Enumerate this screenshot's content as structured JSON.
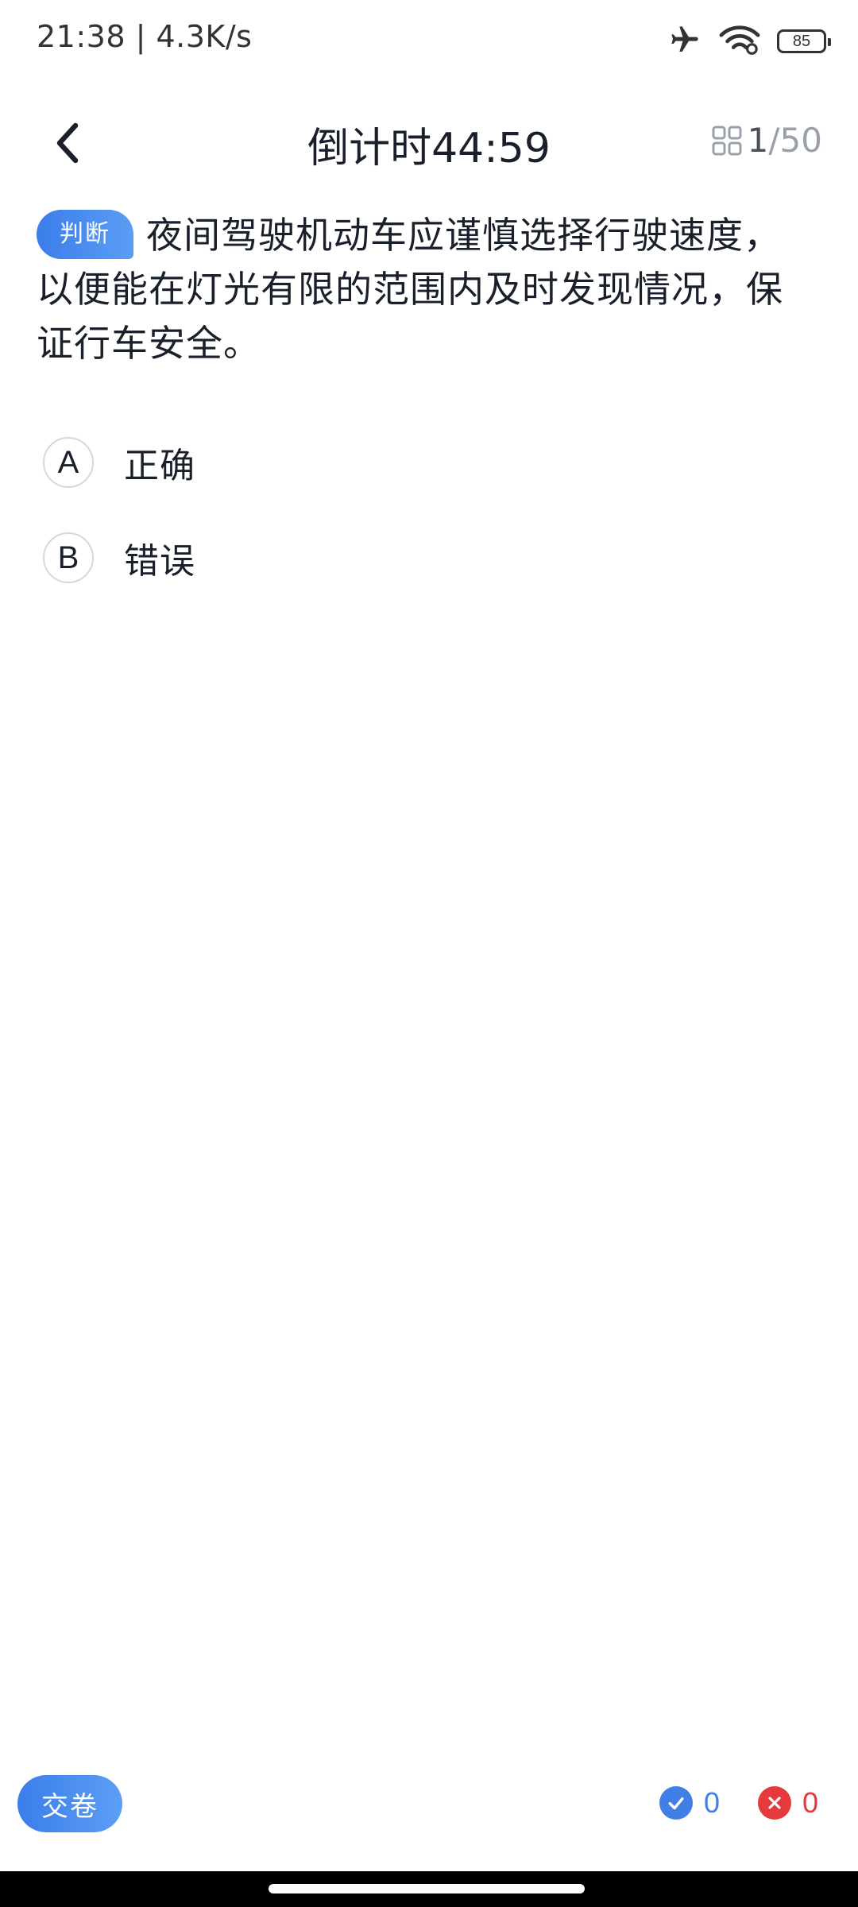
{
  "status_bar": {
    "time_speed": "21:38 | 4.3K/s",
    "battery": "85",
    "icons": [
      "airplane-icon",
      "wifi-icon",
      "battery-icon"
    ]
  },
  "header": {
    "title": "倒计时44:59",
    "progress_current": "1",
    "progress_total": "/50"
  },
  "question": {
    "type_badge": "判断",
    "text": "夜间驾驶机动车应谨慎选择行驶速度，以便能在灯光有限的范围内及时发现情况，保证行车安全。"
  },
  "options": [
    {
      "letter": "A",
      "text": "正确"
    },
    {
      "letter": "B",
      "text": "错误"
    }
  ],
  "bottom_bar": {
    "submit_label": "交卷",
    "correct_count": "0",
    "wrong_count": "0"
  },
  "colors": {
    "accent": "#3b7dea",
    "correct": "#3f7fe6",
    "wrong": "#e5393c"
  }
}
